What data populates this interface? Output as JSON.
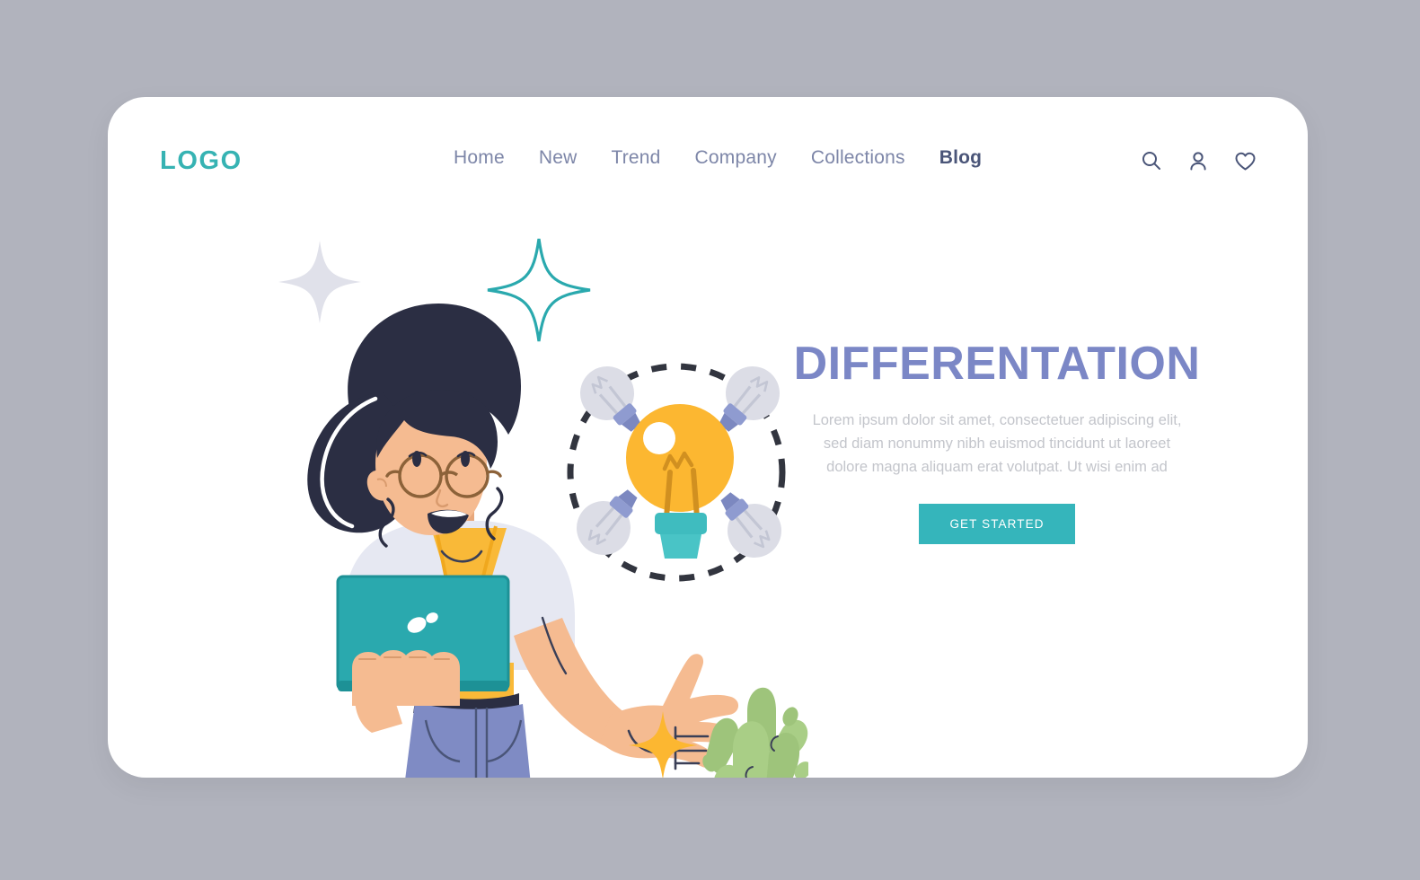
{
  "page": {
    "background_color": "#b1b3bd",
    "card_background": "#ffffff"
  },
  "header": {
    "logo": "LOGO",
    "logo_color": "#36b3b3",
    "nav": [
      {
        "label": "Home",
        "active": false
      },
      {
        "label": "New",
        "active": false
      },
      {
        "label": "Trend",
        "active": false
      },
      {
        "label": "Company",
        "active": false
      },
      {
        "label": "Collections",
        "active": false
      },
      {
        "label": "Blog",
        "active": true
      }
    ],
    "icons": [
      {
        "name": "search-icon"
      },
      {
        "name": "user-icon"
      },
      {
        "name": "heart-icon"
      }
    ]
  },
  "hero": {
    "headline": "DIFFERENTATION",
    "headline_color": "#7b87c6",
    "body": "Lorem ipsum dolor sit amet, consectetuer adipiscing elit, sed diam nonummy nibh euismod tincidunt ut laoreet dolore magna aliquam erat volutpat. Ut wisi enim ad",
    "body_color": "#c3c5cb",
    "cta_label": "GET STARTED",
    "cta_color": "#35b5bb"
  },
  "illustration": {
    "name": "woman-with-laptop-and-idea-bulbs",
    "elements": [
      "sparkle-star-gray",
      "sparkle-star-teal",
      "sparkle-star-yellow",
      "woman-character",
      "laptop-teal",
      "lightbulb-cluster",
      "potted-cactus",
      "ground-line-left",
      "ground-line-right"
    ],
    "colors": {
      "hair": "#2b2e43",
      "skin": "#f5bb91",
      "shirt": "#e6e8f2",
      "top": "#f9b938",
      "jeans": "#7f8bc4",
      "laptop": "#2aa9ae",
      "bulb_center": "#fcb731",
      "bulb_base_center": "#3fbcbf",
      "bulb_gray": "#dcdde6",
      "bulb_base_gray": "#8f9bd0",
      "pot": "#ec5428",
      "plant": "#9ec47b",
      "ground": "#5a6480",
      "star_gray": "#e0e1ea",
      "star_teal": "#2aa9ae",
      "star_yellow": "#fcb731"
    }
  }
}
